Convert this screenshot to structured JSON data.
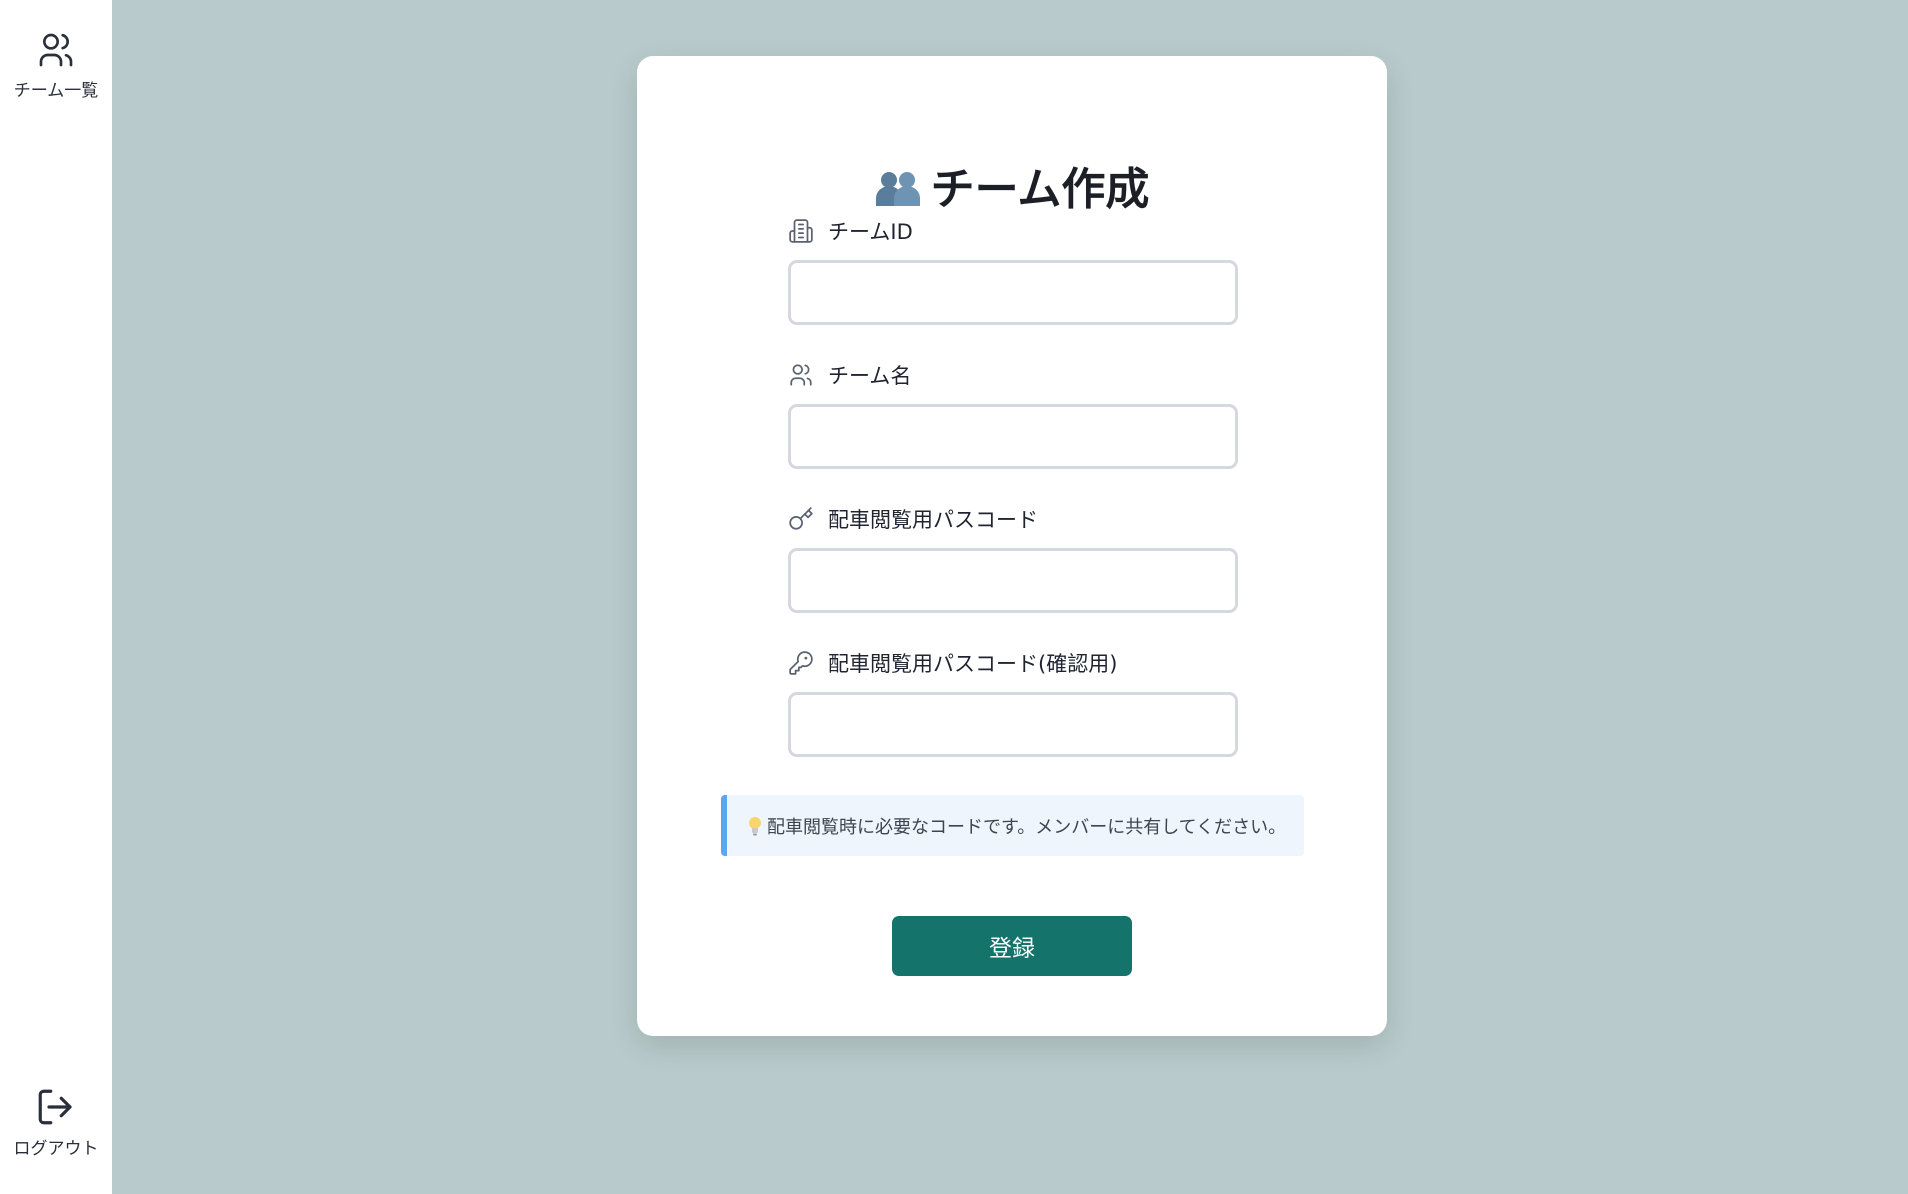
{
  "sidebar": {
    "top_item": {
      "label": "チーム一覧",
      "icon": "users-icon"
    },
    "bottom_item": {
      "label": "ログアウト",
      "icon": "logout-icon"
    }
  },
  "form": {
    "title": "チーム作成",
    "title_icon": "two-people-emoji",
    "fields": [
      {
        "label": "チームID",
        "icon": "building-icon",
        "value": ""
      },
      {
        "label": "チーム名",
        "icon": "users-icon",
        "value": ""
      },
      {
        "label": "配車閲覧用パスコード",
        "icon": "key-icon",
        "value": ""
      },
      {
        "label": "配車閲覧用パスコード(確認用)",
        "icon": "key-round-icon",
        "value": ""
      }
    ],
    "hint": "配車閲覧時に必要なコードです。メンバーに共有してください。",
    "hint_icon": "lightbulb-icon",
    "submit_label": "登録"
  },
  "colors": {
    "background": "#b8cacb",
    "primary_button": "#14746c",
    "hint_border": "#5aa6f0",
    "hint_background": "#eff5fd"
  }
}
